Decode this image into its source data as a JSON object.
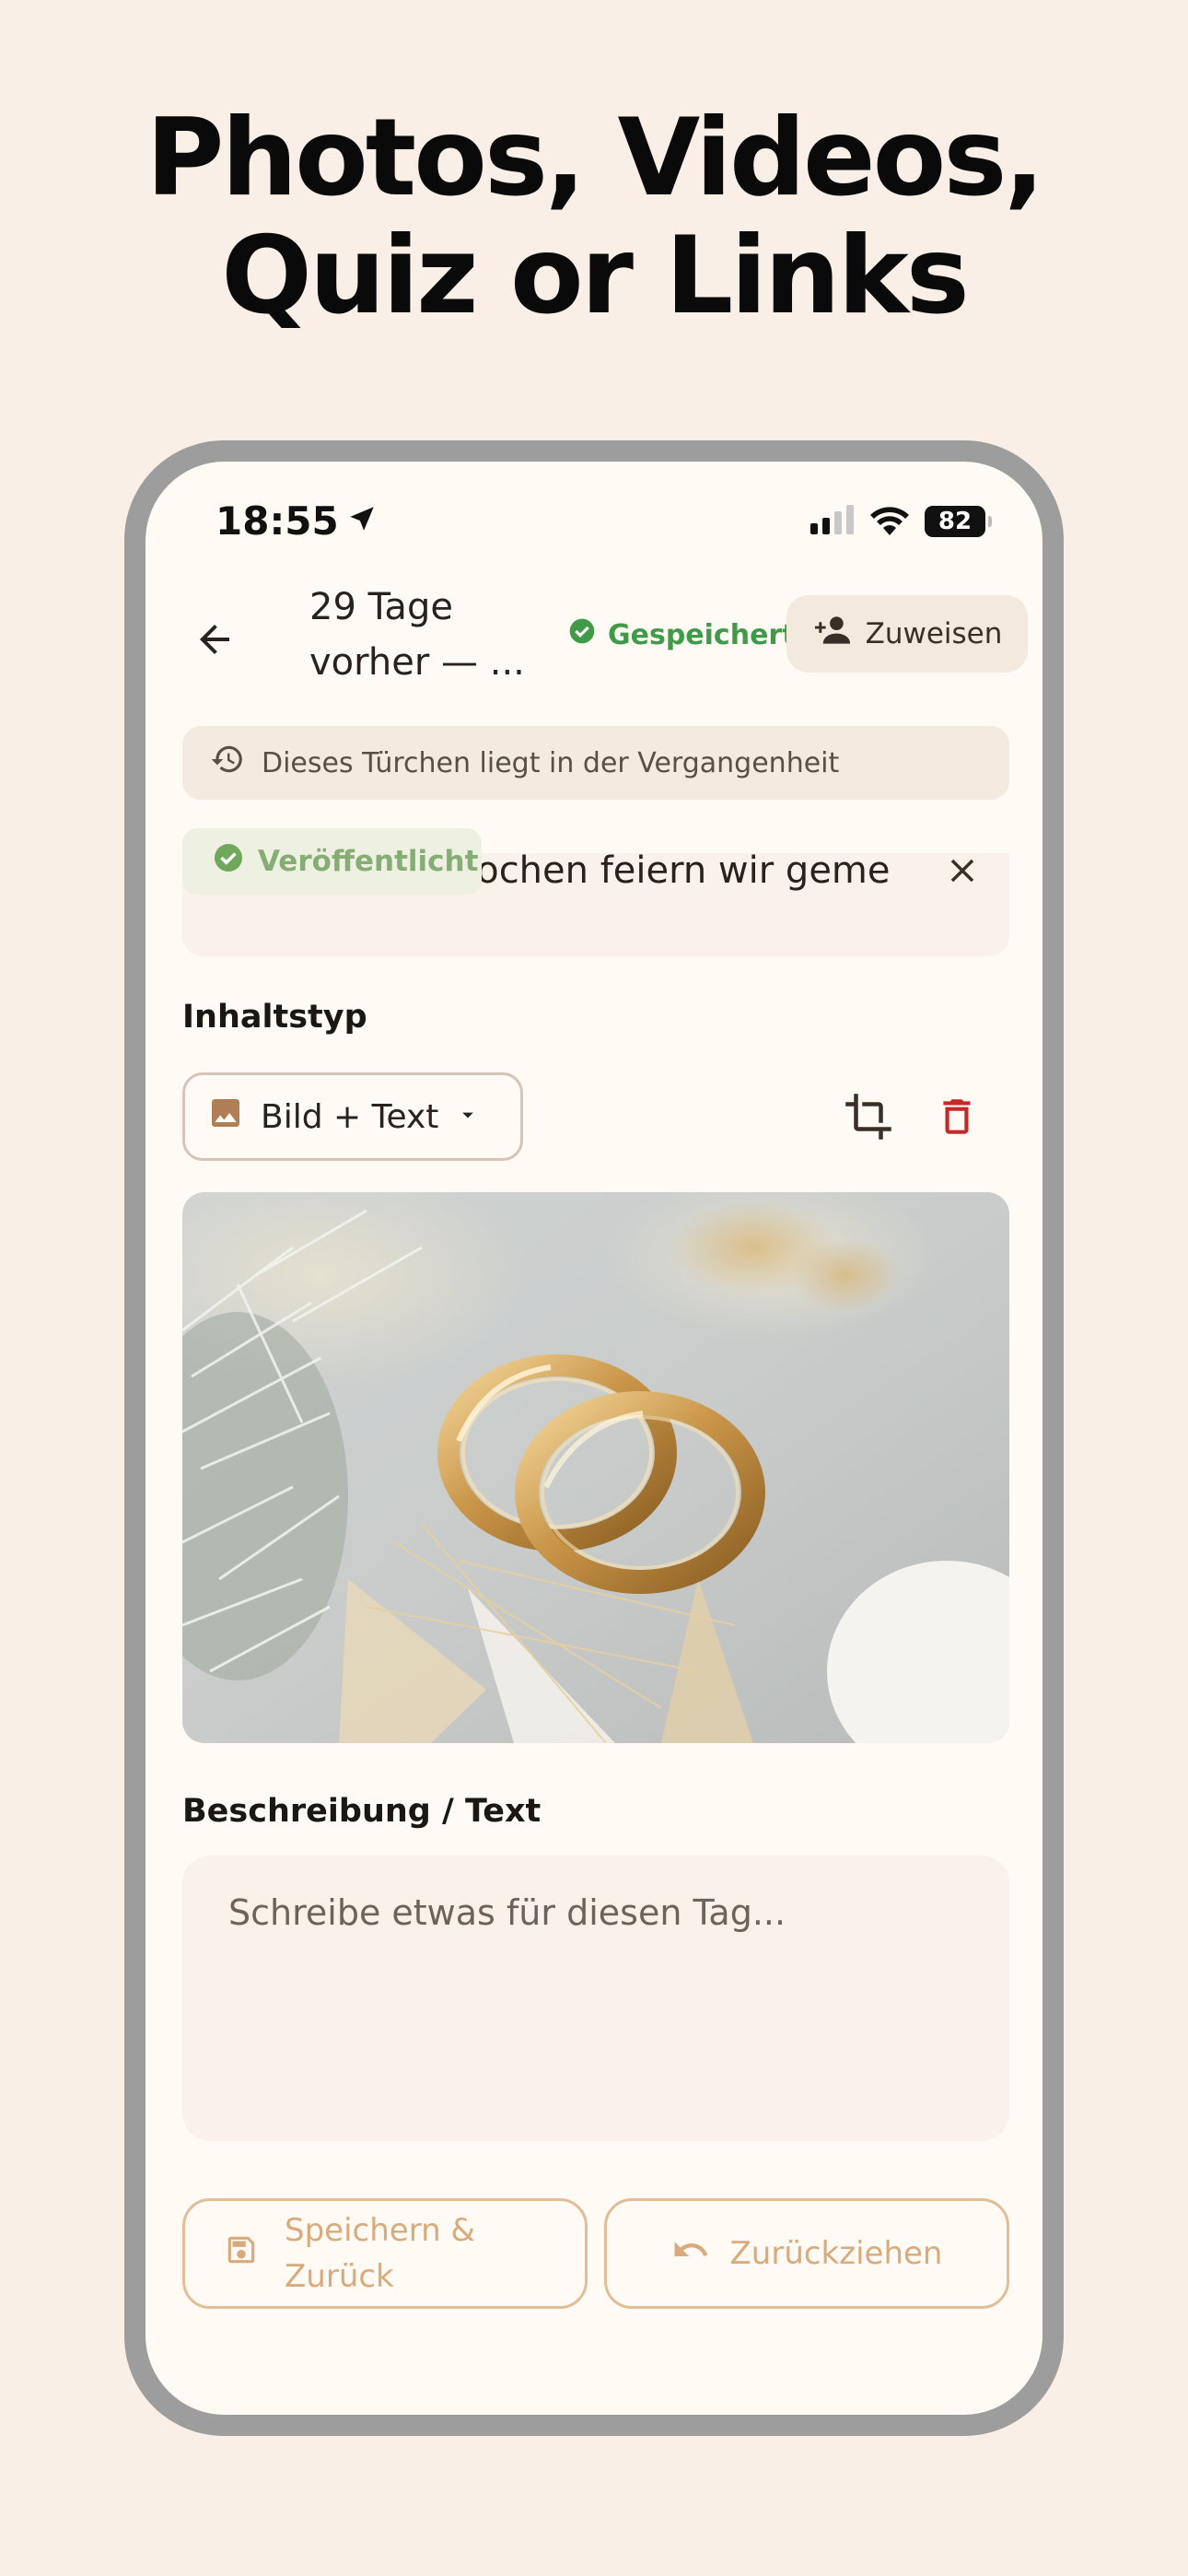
{
  "headline": {
    "line1": "Photos, Videos,",
    "line2": "Quiz or Links"
  },
  "status_bar": {
    "time": "18:55",
    "battery": "82"
  },
  "app_bar": {
    "title": "29 Tage vorher — ...",
    "saved_label": "Gespeichert",
    "assign_label": "Zuweisen"
  },
  "past_banner": "Dieses Türchen liegt in der Vergangenheit",
  "published_badge": "Veröffentlicht",
  "text_preview": "In zwei Wochen feiern wir gemein",
  "content_type": {
    "label": "Inhaltstyp",
    "selected": "Bild + Text"
  },
  "description": {
    "label": "Beschreibung / Text",
    "placeholder": "Schreibe etwas für diesen Tag..."
  },
  "actions": {
    "save_back": "Speichern & Zurück",
    "retract": "Zurückziehen"
  },
  "colors": {
    "background": "#f9efe6",
    "screen": "#fffbf4",
    "saved_green": "#3f9b48",
    "delete_red": "#c62828",
    "button_accent": "#d9aa7b"
  }
}
